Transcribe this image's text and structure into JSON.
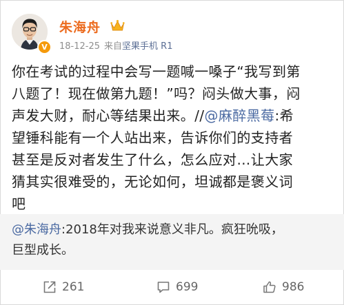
{
  "post": {
    "author": "朱海舟",
    "verified_badge": "V",
    "date": "18-12-25",
    "source_prefix": "来自",
    "client": "坚果手机 R1",
    "lines": [
      {
        "text": "你在考试的过程中会写一题喊一嗓子“我写到第"
      },
      {
        "text": "八题了！现在做第九题！”吗？闷头做大事，闷"
      },
      {
        "pre": "声发大财，耐心等结果出来。//",
        "mention": "@麻醉黑莓",
        "post": ":希"
      },
      {
        "text": "望锤科能有一个人站出来，告诉你们的支持者"
      },
      {
        "text": "甚至是反对者发生了什么，怎么应对…让大家"
      },
      {
        "text": "猜其实很难受的，无论如何，坦诚都是褒义词"
      },
      {
        "text": "吧"
      }
    ]
  },
  "quote": {
    "mention": "@朱海舟",
    "line1": ":2018年对我来说意义非凡。疯狂吮吸，",
    "line2": "巨型成长。"
  },
  "actions": {
    "repost_count": "261",
    "comment_count": "699",
    "like_count": "986"
  },
  "colors": {
    "name": "#ec6b1e",
    "mention": "#4b6aa2",
    "client": "#5c6f95",
    "quote_bg": "#f4f4f4",
    "badge": "#f59a0b"
  }
}
